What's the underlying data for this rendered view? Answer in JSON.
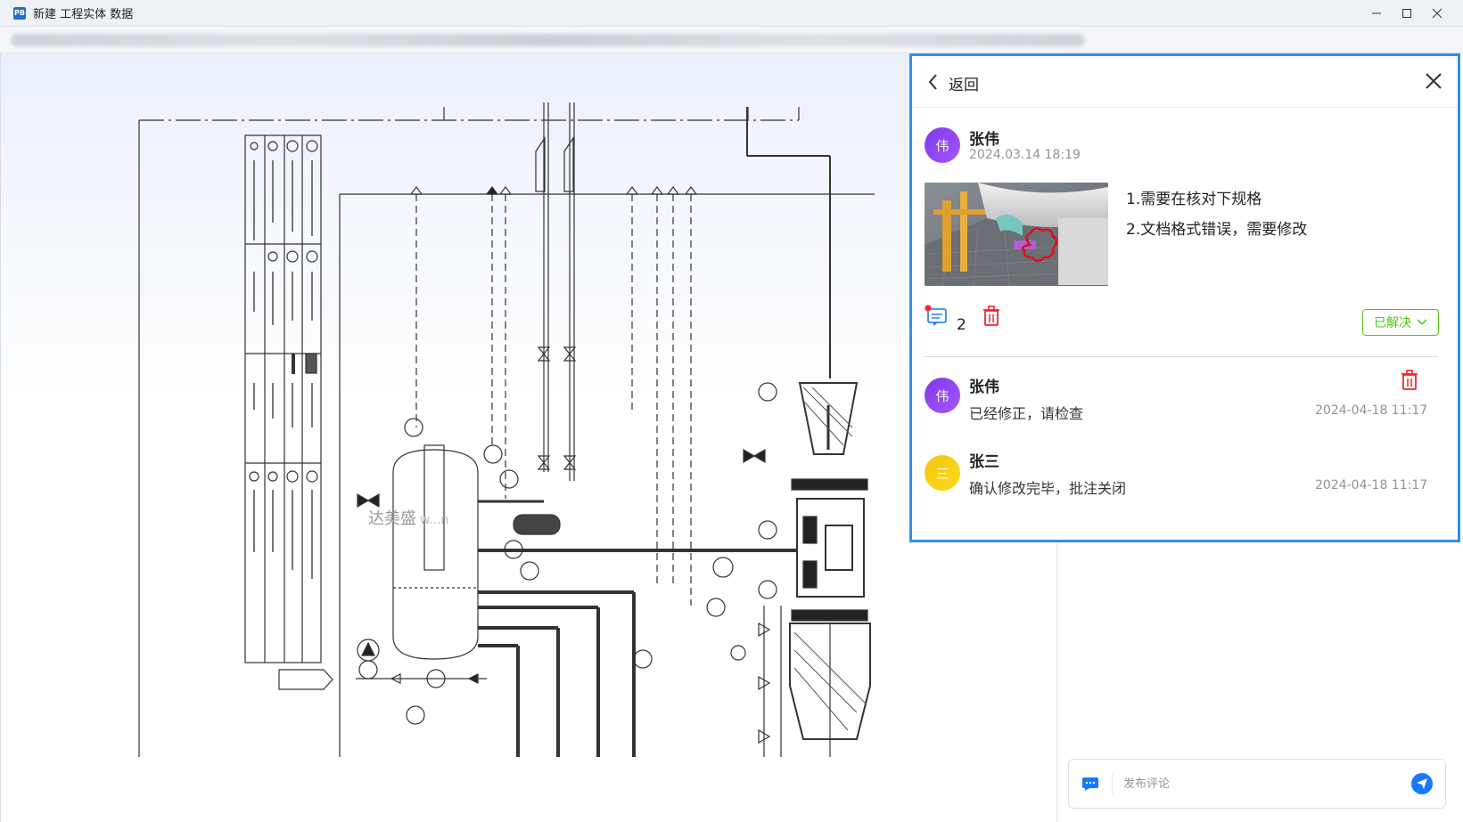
{
  "window": {
    "title": "新建 工程实体 数据",
    "icon": "app-logo-icon",
    "controls": [
      "minimize-icon",
      "maximize-icon",
      "close-icon"
    ]
  },
  "drawing": {
    "watermark": "达美盛",
    "watermark_tail": "w...n"
  },
  "panel": {
    "back_label": "返回",
    "author": {
      "avatar_text": "伟",
      "name": "张伟",
      "date": "2024.03.14 18:19"
    },
    "notes": [
      "1.需要在核对下规格",
      "2.文档格式错误，需要修改"
    ],
    "reply_count": "2",
    "status": "已解决",
    "colors": {
      "accent": "#2f8ff0",
      "resolved": "#52c41a",
      "delete": "#f5222d"
    },
    "replies": [
      {
        "avatar_text": "伟",
        "name": "张伟",
        "text": "已经修正，请检查",
        "time": "2024-04-18 11:17"
      },
      {
        "avatar_text": "三",
        "name": "张三",
        "text": "确认修改完毕，批注关闭",
        "time": "2024-04-18 11:17"
      }
    ]
  },
  "comment": {
    "placeholder": "发布评论"
  }
}
